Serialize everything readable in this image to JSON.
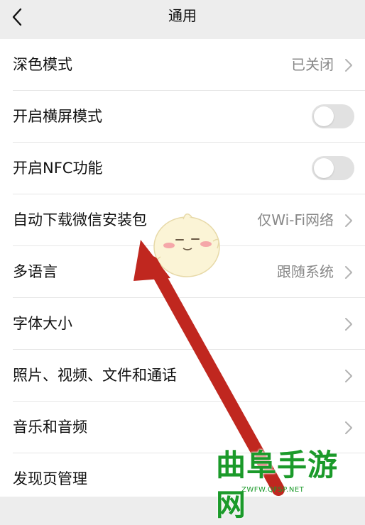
{
  "header": {
    "title": "通用",
    "back_icon": "chevron-left-icon"
  },
  "settings": [
    {
      "label": "深色模式",
      "value": "已关闭",
      "type": "link"
    },
    {
      "label": "开启横屏模式",
      "type": "toggle",
      "on": false
    },
    {
      "label": "开启NFC功能",
      "type": "toggle",
      "on": false
    },
    {
      "label": "自动下载微信安装包",
      "value": "仅Wi-Fi网络",
      "type": "link"
    },
    {
      "label": "多语言",
      "value": "跟随系统",
      "type": "link"
    },
    {
      "label": "字体大小",
      "type": "link"
    },
    {
      "label": "照片、视频、文件和通话",
      "type": "link"
    },
    {
      "label": "音乐和音频",
      "type": "link"
    },
    {
      "label": "发现页管理",
      "type": "link"
    }
  ],
  "annotation": {
    "arrow_color": "#c0271f"
  },
  "watermark": {
    "text": "曲阜手游网",
    "url": "ZWFW.QFSP.NET",
    "color": "#1b9a2a"
  }
}
